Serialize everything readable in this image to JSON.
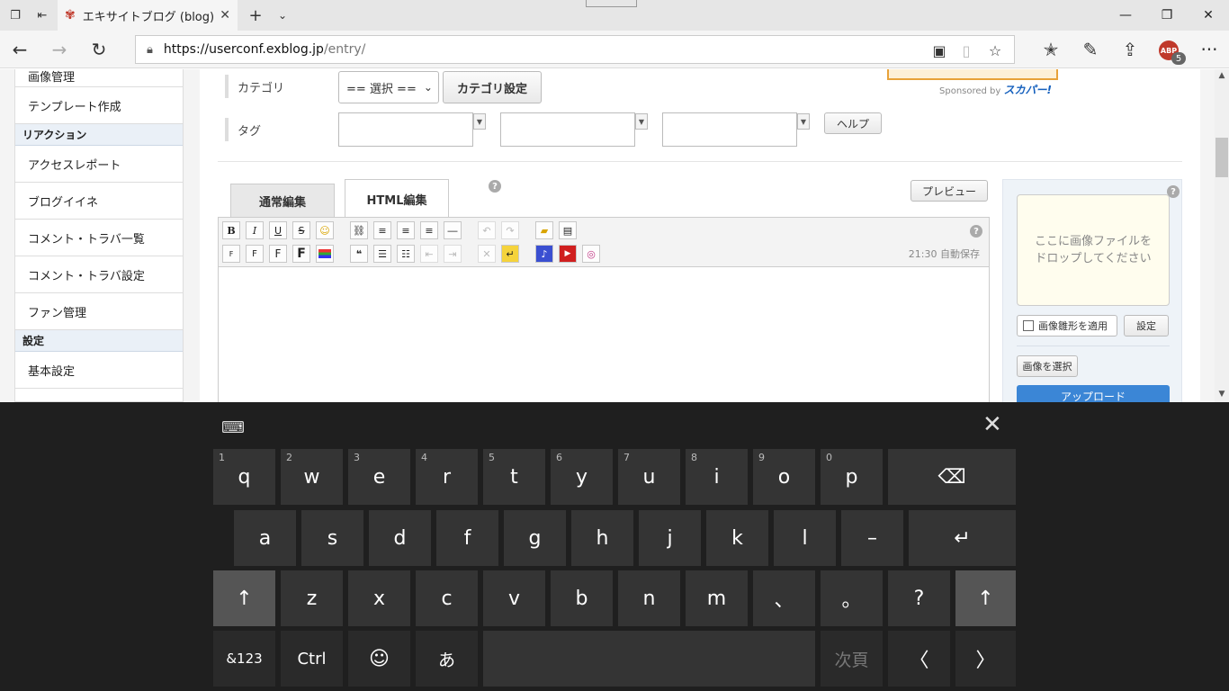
{
  "browser": {
    "tab_title": "エキサイトブログ (blog)|新ﾀ",
    "url_host": "https://userconf.exblog.jp",
    "url_path": "/entry/",
    "abp_label": "ABP",
    "abp_count": "5"
  },
  "sidebar": {
    "items": [
      {
        "type": "item",
        "label": "画像管理"
      },
      {
        "type": "item",
        "label": "テンプレート作成"
      },
      {
        "type": "head",
        "label": "リアクション"
      },
      {
        "type": "item",
        "label": "アクセスレポート"
      },
      {
        "type": "item",
        "label": "ブログイイネ"
      },
      {
        "type": "item",
        "label": "コメント・トラバ一覧"
      },
      {
        "type": "item",
        "label": "コメント・トラバ設定"
      },
      {
        "type": "item",
        "label": "ファン管理"
      },
      {
        "type": "head",
        "label": "設定"
      },
      {
        "type": "item",
        "label": "基本設定"
      }
    ]
  },
  "form": {
    "category_label": "カテゴリ",
    "category_select": "== 選択 ==",
    "category_settings_button": "カテゴリ設定",
    "tag_label": "タグ",
    "help_button": "ヘルプ",
    "sponsor_text": "Sponsored by",
    "sponsor_brand": "スカパー!"
  },
  "editor": {
    "tab_normal": "通常編集",
    "tab_html": "HTML編集",
    "preview_button": "プレビュー",
    "autosave": "21:30 自動保存",
    "help_mark": "?"
  },
  "image_panel": {
    "drop_text_line1": "ここに画像ファイルを",
    "drop_text_line2": "ドロップしてください",
    "apply_template": "画像雛形を適用",
    "settings_button": "設定",
    "select_image_button": "画像を選択",
    "upload_button": "アップロード"
  },
  "keyboard": {
    "row1": [
      {
        "k": "q",
        "n": "1"
      },
      {
        "k": "w",
        "n": "2"
      },
      {
        "k": "e",
        "n": "3"
      },
      {
        "k": "r",
        "n": "4"
      },
      {
        "k": "t",
        "n": "5"
      },
      {
        "k": "y",
        "n": "6"
      },
      {
        "k": "u",
        "n": "7"
      },
      {
        "k": "i",
        "n": "8"
      },
      {
        "k": "o",
        "n": "9"
      },
      {
        "k": "p",
        "n": "0"
      }
    ],
    "row2": [
      "a",
      "s",
      "d",
      "f",
      "g",
      "h",
      "j",
      "k",
      "l",
      "–"
    ],
    "row3": [
      "z",
      "x",
      "c",
      "v",
      "b",
      "n",
      "m",
      "、",
      "。",
      "?"
    ],
    "symbols_key": "&123",
    "ctrl_key": "Ctrl",
    "kana_key": "あ",
    "next_page_key": "次頁"
  }
}
